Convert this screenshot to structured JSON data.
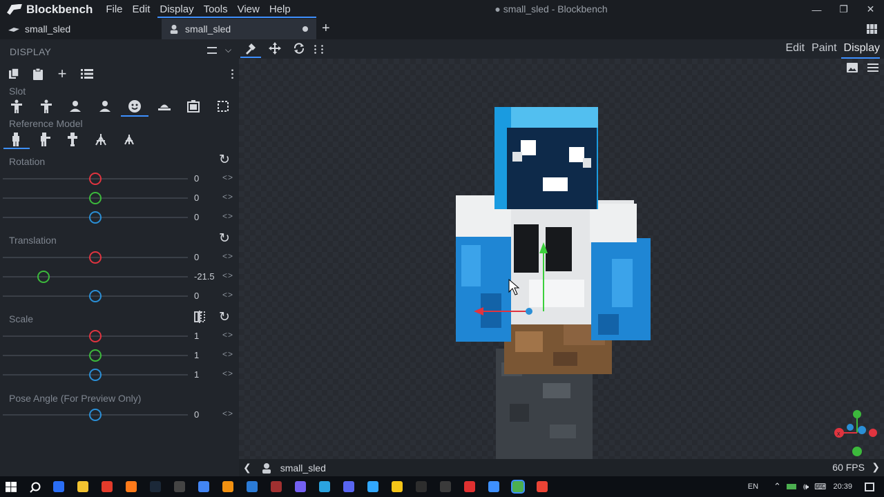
{
  "app": {
    "name": "Blockbench",
    "window_title": "● small_sled - Blockbench"
  },
  "menu": [
    "File",
    "Edit",
    "Display",
    "Tools",
    "View",
    "Help"
  ],
  "window_controls": {
    "minimize": "—",
    "maximize": "❐",
    "close": "✕"
  },
  "tabs": [
    {
      "label": "small_sled",
      "active": false
    },
    {
      "label": "small_sled",
      "active": true,
      "unsaved": true
    }
  ],
  "new_tab": "+",
  "sidebar": {
    "title": "DISPLAY",
    "slot_label": "Slot",
    "reference_label": "Reference Model",
    "selected_slot": "head",
    "selected_reference": "player",
    "rotation": {
      "label": "Rotation",
      "rows": [
        {
          "axis": "x",
          "value": "0",
          "color": "#e0343f",
          "position": 0.5
        },
        {
          "axis": "y",
          "value": "0",
          "color": "#3cb93c",
          "position": 0.5
        },
        {
          "axis": "z",
          "value": "0",
          "color": "#2a8fd6",
          "position": 0.5
        }
      ]
    },
    "translation": {
      "label": "Translation",
      "rows": [
        {
          "axis": "x",
          "value": "0",
          "color": "#e0343f",
          "position": 0.5
        },
        {
          "axis": "y",
          "value": "-21.5",
          "color": "#3cb93c",
          "position": 0.22
        },
        {
          "axis": "z",
          "value": "0",
          "color": "#2a8fd6",
          "position": 0.5
        }
      ]
    },
    "scale": {
      "label": "Scale",
      "rows": [
        {
          "axis": "x",
          "value": "1",
          "color": "#e0343f",
          "position": 0.5
        },
        {
          "axis": "y",
          "value": "1",
          "color": "#3cb93c",
          "position": 0.5
        },
        {
          "axis": "z",
          "value": "1",
          "color": "#2a8fd6",
          "position": 0.5
        }
      ]
    },
    "pose": {
      "label": "Pose Angle (For Preview Only)",
      "value": "0",
      "color": "#2a8fd6",
      "position": 0.5
    },
    "arrows": "<>"
  },
  "modes": [
    "Edit",
    "Paint",
    "Display"
  ],
  "active_mode": "Display",
  "statusbar": {
    "project": "small_sled",
    "fps": "60 FPS"
  },
  "taskbar": {
    "lang": "EN",
    "time": "20:39",
    "app_colors": [
      "#2a6ef5",
      "#f2c230",
      "#e23b2b",
      "#ff7a1a",
      "#1b2838",
      "#444444",
      "#4285f4",
      "#f29111",
      "#2b7bd6",
      "#a03030",
      "#7360f2",
      "#2aa3e0",
      "#5865f2",
      "#31a8ff",
      "#f5c518",
      "#2d2d2d",
      "#3a3a3a",
      "#e03030",
      "#3e90ff",
      "#4caf50",
      "#ea4335"
    ]
  }
}
